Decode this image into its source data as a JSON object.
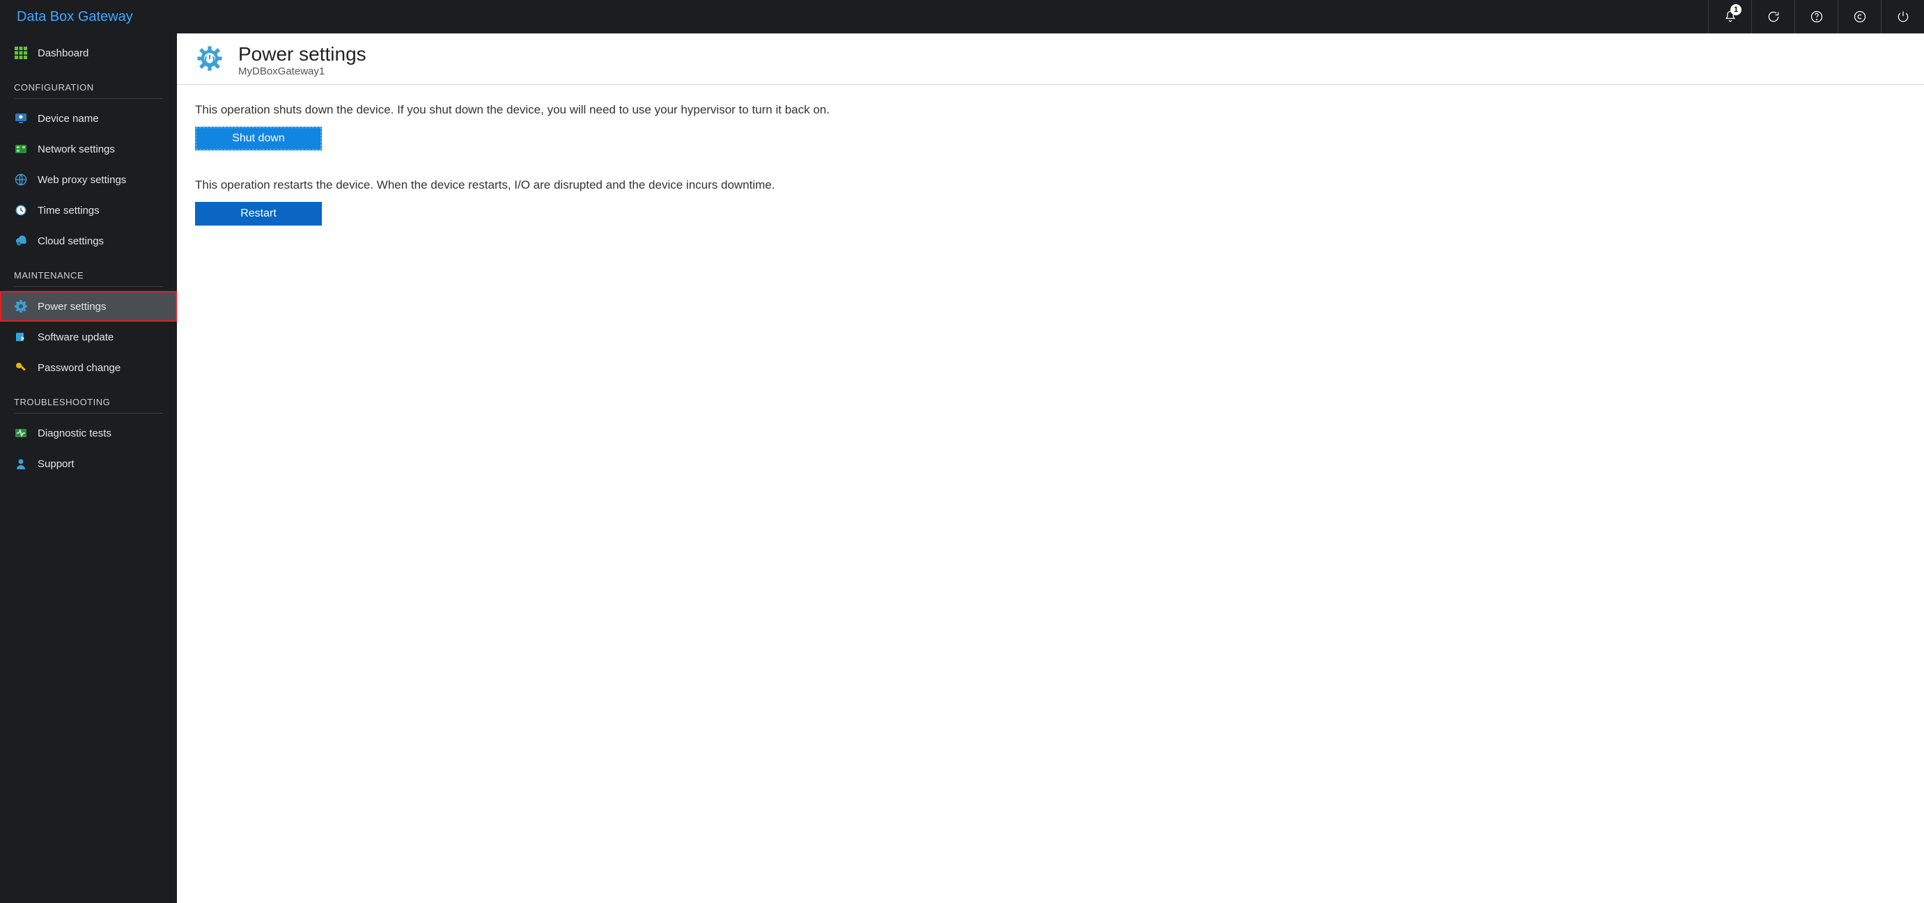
{
  "brand": "Data Box Gateway",
  "topbar": {
    "notification_count": "1"
  },
  "sidebar": {
    "dashboard": "Dashboard",
    "sections": {
      "configuration": {
        "header": "CONFIGURATION",
        "items": {
          "device_name": "Device name",
          "network_settings": "Network settings",
          "web_proxy_settings": "Web proxy settings",
          "time_settings": "Time settings",
          "cloud_settings": "Cloud settings"
        }
      },
      "maintenance": {
        "header": "MAINTENANCE",
        "items": {
          "power_settings": "Power settings",
          "software_update": "Software update",
          "password_change": "Password change"
        }
      },
      "troubleshooting": {
        "header": "TROUBLESHOOTING",
        "items": {
          "diagnostic_tests": "Diagnostic tests",
          "support": "Support"
        }
      }
    }
  },
  "page": {
    "title": "Power settings",
    "subtitle": "MyDBoxGateway1",
    "shutdown_desc": "This operation shuts down the device. If you shut down the device, you will need to use your hypervisor to turn it back on.",
    "shutdown_btn": "Shut down",
    "restart_desc": "This operation restarts the device. When the device restarts, I/O are disrupted and the device incurs downtime.",
    "restart_btn": "Restart"
  }
}
